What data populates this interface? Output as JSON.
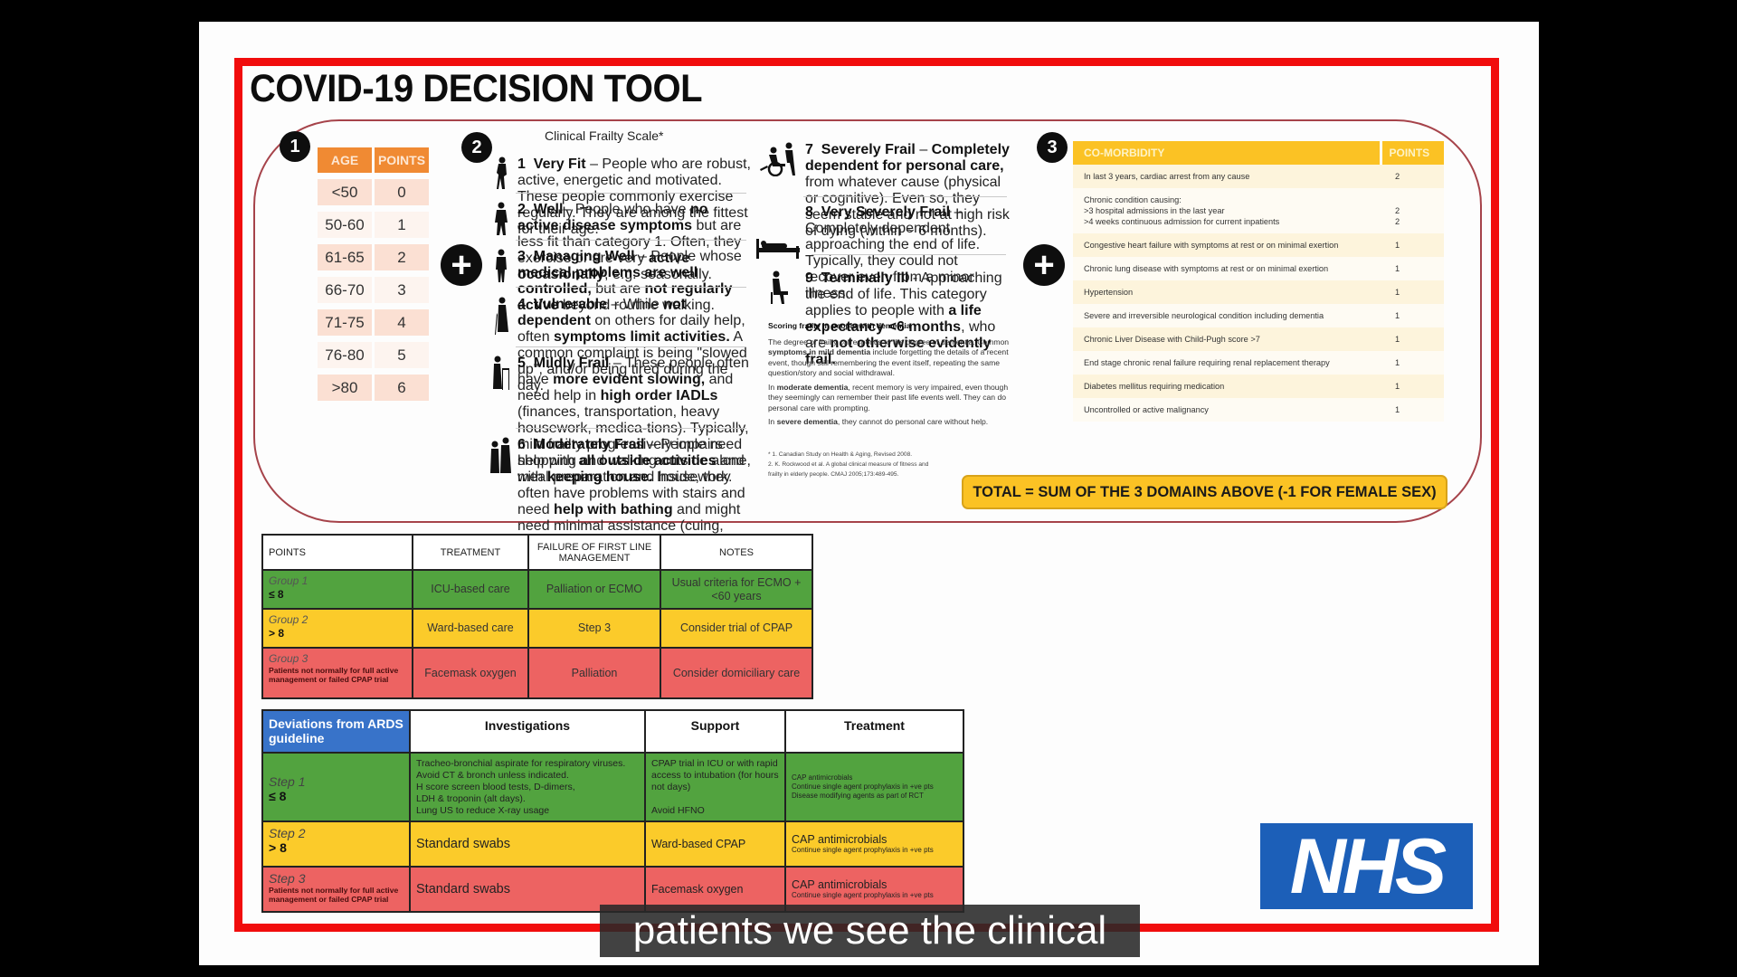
{
  "title": "COVID-19 DECISION TOOL",
  "colors": {
    "frame_red": "#f10d0d",
    "age_header": "#f08a33",
    "comorbidity_header": "#fbc224",
    "group_green": "#52a33f",
    "group_yellow": "#fbcb2a",
    "group_red": "#ed6362",
    "deviation_blue": "#3873c9",
    "nhs_blue": "#1c5fb8"
  },
  "badges": {
    "one": "1",
    "two": "2",
    "three": "3",
    "plus": "+"
  },
  "age_table": {
    "headers": [
      "AGE",
      "POINTS"
    ],
    "rows": [
      {
        "age": "<50",
        "points": "0"
      },
      {
        "age": "50-60",
        "points": "1"
      },
      {
        "age": "61-65",
        "points": "2"
      },
      {
        "age": "66-70",
        "points": "3"
      },
      {
        "age": "71-75",
        "points": "4"
      },
      {
        "age": "76-80",
        "points": "5"
      },
      {
        "age": ">80",
        "points": "6"
      }
    ]
  },
  "frailty_scale": {
    "title": "Clinical Frailty Scale*",
    "items": [
      {
        "num": "1",
        "name": "Very Fit",
        "text": "– People who are robust, active, energetic and motivated.  These people commonly exercise regularly.  They are among the fittest for their age."
      },
      {
        "num": "2",
        "name": "Well",
        "text_a": "–  People who have ",
        "bold_a": "no active disease symptoms",
        "text_b": " but are less fit than category 1. Often, they exercise or are very ",
        "bold_b": "active occasionally",
        "text_c": ", e.g. seasonally."
      },
      {
        "num": "3",
        "name": "Managing Well",
        "text_a": " – People whose ",
        "bold_a": "medical problems are well controlled,",
        "text_b": " but are ",
        "bold_b": "not regularly active",
        "text_c": " beyond routine walking."
      },
      {
        "num": "4",
        "name": "Vulnerable",
        "text_a": " – While ",
        "bold_a": "not dependent",
        "text_b": " on others for daily help, often ",
        "bold_b": "symptoms limit activities.",
        "text_c": " A common complaint is being \"slowed up\", and/or being tired during the day."
      },
      {
        "num": "5",
        "name": "Mildly Frail",
        "text_a": " –  These people often have ",
        "bold_a": "more evident slowing,",
        "text_b": " and need help in ",
        "bold_b": "high order IADLs",
        "text_c": " (finances, transportation, heavy housework, medica-tions).  Typically, mild frailty progressively impairs shopping and walking outside alone, meal preparation and housework."
      },
      {
        "num": "6",
        "name": "Moderately Frail",
        "text_a": " – People need help with ",
        "bold_a": "all outside activities",
        "text_b": " and with ",
        "bold_b": "keeping house.",
        "text_c": " Inside, they often have problems with stairs and need ",
        "bold_c": "help with bathing",
        "text_d": " and might need minimal assistance (cuing, standby) with dressing."
      },
      {
        "num": "7",
        "name": "Severely Frail",
        "text_a": " – ",
        "bold_a": "Completely dependent for personal care,",
        "text_b": " from whatever cause (physical or cognitive).  Even so, they seem stable and not at high risk of dying (within ~ 6 months)."
      },
      {
        "num": "8",
        "name": "Very Severely Frail",
        "text_a": " – Completely dependent, approaching the end of life. Typically, they could not recover even from a minor illness."
      },
      {
        "num": "9",
        "name": "Terminally Ill",
        "text_a": " - Approaching the end of life. This category applies to people with ",
        "bold_a": "a life expectancy <6 months",
        "text_b": ", who are ",
        "bold_b": "not otherwise evidently frail."
      }
    ],
    "dementia": {
      "heading": "Scoring frailty in people with dementia",
      "p1_a": "The degree of frailty corresponds to the degree of dementia. Common ",
      "p1_bold": "symptoms in mild dementia",
      "p1_b": " include forgetting the details of a recent event, though still remembering the event itself, repeating the same question/story and social withdrawal.",
      "p2_a": "In ",
      "p2_bold": "moderate dementia",
      "p2_b": ", recent memory is very impaired, even though they seemingly can remember their past life events well. They can do personal care with prompting.",
      "p3_a": "In ",
      "p3_bold": "severe dementia",
      "p3_b": ", they cannot do personal care without help."
    },
    "references": [
      "* 1. Canadian Study on Health & Aging, Revised 2008.",
      "2. K. Rockwood et al. A global clinical measure of fitness and",
      "frailty in elderly people. CMAJ 2005;173:489-495."
    ]
  },
  "comorbidity": {
    "headers": [
      "CO-MORBIDITY",
      "POINTS"
    ],
    "rows": [
      {
        "condition": "In last 3 years, cardiac arrest from any cause",
        "points": "2"
      },
      {
        "condition_lines": [
          "Chronic condition causing:",
          ">3 hospital admissions in the last year",
          ">4 weeks continuous admission for current inpatients"
        ],
        "points_lines": [
          "",
          "2",
          "2"
        ]
      },
      {
        "condition": "Congestive heart failure with symptoms at rest or on minimal exertion",
        "points": "1"
      },
      {
        "condition": "Chronic lung disease with symptoms at rest or on minimal exertion",
        "points": "1"
      },
      {
        "condition": "Hypertension",
        "points": "1"
      },
      {
        "condition": "Severe and irreversible neurological condition including dementia",
        "points": "1"
      },
      {
        "condition": "Chronic Liver Disease with Child-Pugh score >7",
        "points": "1"
      },
      {
        "condition": "End stage chronic renal failure requiring renal replacement therapy",
        "points": "1"
      },
      {
        "condition": "Diabetes mellitus requiring medication",
        "points": "1"
      },
      {
        "condition": "Uncontrolled or active malignancy",
        "points": "1"
      }
    ]
  },
  "total_label": "TOTAL = SUM OF THE 3 DOMAINS ABOVE (-1 FOR FEMALE SEX)",
  "group_table": {
    "headers": [
      "POINTS",
      "TREATMENT",
      "FAILURE OF FIRST LINE MANAGEMENT",
      "NOTES"
    ],
    "rows": [
      {
        "group": "Group 1",
        "score": "≤ 8",
        "note": "",
        "treatment": "ICU-based care",
        "failure": "Palliation or ECMO",
        "notes": "Usual criteria for ECMO + <60 years"
      },
      {
        "group": "Group 2",
        "score": "> 8",
        "note": "",
        "treatment": "Ward-based care",
        "failure": "Step 3",
        "notes": "Consider trial of CPAP"
      },
      {
        "group": "Group 3",
        "score": "",
        "note": "Patients not normally for full active management or  failed CPAP trial",
        "treatment": "Facemask oxygen",
        "failure": "Palliation",
        "notes": "Consider domiciliary care"
      }
    ]
  },
  "deviation_table": {
    "headers": [
      "Deviations from ARDS guideline",
      "Investigations",
      "Support",
      "Treatment"
    ],
    "rows": [
      {
        "step": "Step 1",
        "score": "≤ 8",
        "note": "",
        "investigations": [
          "Tracheo-bronchial aspirate for respiratory viruses.",
          "Avoid CT & bronch unless indicated.",
          "H score screen blood tests, D-dimers,",
          "LDH & troponin (alt days).",
          "Lung US to reduce X-ray usage"
        ],
        "support": [
          "CPAP trial in ICU or with rapid access to intubation (for hours not days)",
          "Avoid HFNO"
        ],
        "treatment_main": "",
        "treatment_lines": [
          "CAP antimicrobials",
          "Continue single agent prophylaxis in +ve pts",
          "Disease modifying agents as part of RCT"
        ]
      },
      {
        "step": "Step 2",
        "score": "> 8",
        "note": "",
        "investigations": [
          "Standard swabs"
        ],
        "support": [
          "Ward-based CPAP"
        ],
        "treatment_main": "CAP antimicrobials",
        "treatment_lines": [
          "Continue single agent prophylaxis in +ve pts"
        ]
      },
      {
        "step": "Step 3",
        "score": "",
        "note": "Patients not normally for full active management or failed CPAP trial",
        "investigations": [
          "Standard swabs"
        ],
        "support": [
          "Facemask oxygen"
        ],
        "treatment_main": "CAP antimicrobials",
        "treatment_lines": [
          "Continue single agent prophylaxis in +ve pts"
        ]
      }
    ]
  },
  "logo": "NHS",
  "caption": "patients we see the clinical"
}
